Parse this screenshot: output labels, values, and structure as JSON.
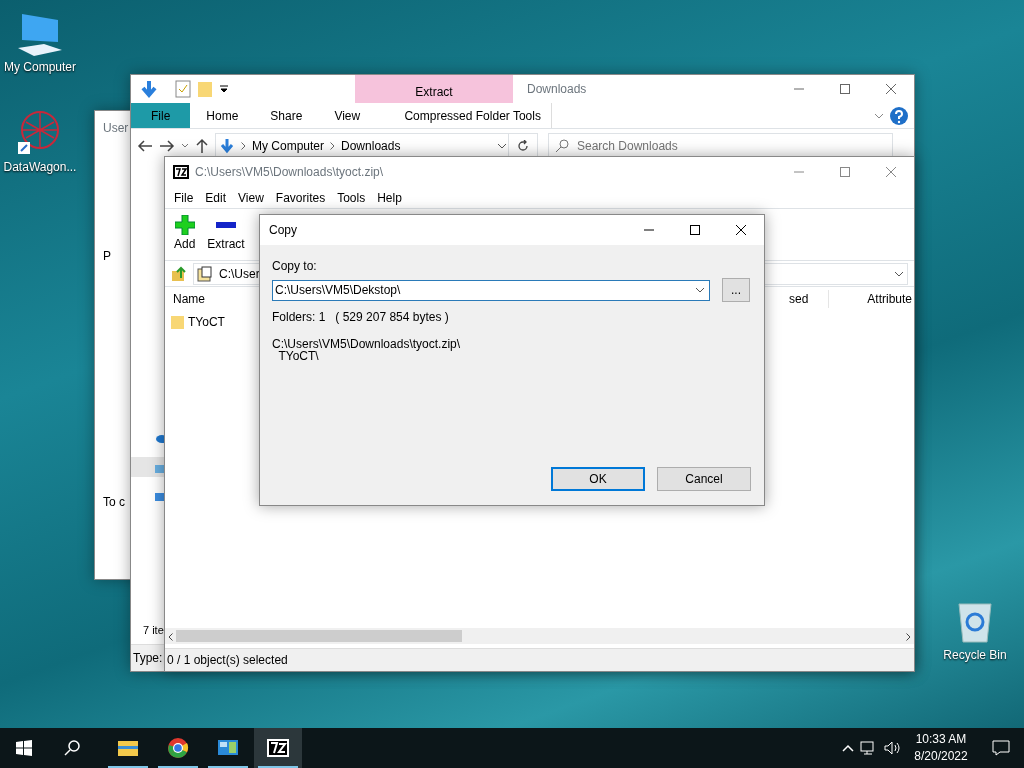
{
  "desktop_icons": [
    {
      "kind": "computer",
      "label": "My Computer"
    },
    {
      "kind": "app",
      "label": "DataWagon..."
    },
    {
      "kind": "bin",
      "label": "Recycle Bin"
    }
  ],
  "background_window": {
    "title": "User",
    "texts": [
      "P",
      "To c"
    ]
  },
  "explorer": {
    "title": "Downloads",
    "contextual_group": "Extract",
    "tabs": [
      {
        "label": "File",
        "selected": true
      },
      {
        "label": "Home",
        "selected": false
      },
      {
        "label": "Share",
        "selected": false
      },
      {
        "label": "View",
        "selected": false
      },
      {
        "label": "Compressed Folder Tools",
        "selected": false
      }
    ],
    "breadcrumb": [
      "My Computer",
      "Downloads"
    ],
    "search": {
      "placeholder": "Search Downloads"
    },
    "item_count": "7 ite",
    "type_label": "Type: "
  },
  "archive_window": {
    "title": "C:\\Users\\VM5\\Downloads\\tyoct.zip\\",
    "menu": [
      "File",
      "Edit",
      "View",
      "Favorites",
      "Tools",
      "Help"
    ],
    "toolbar": [
      {
        "kind": "add",
        "label": "Add"
      },
      {
        "kind": "extract",
        "label": "Extract"
      }
    ],
    "address": "C:\\User",
    "columns": [
      "Name",
      "sed",
      "Attribute"
    ],
    "rows": [
      {
        "name": "TYoCT"
      }
    ],
    "status": "0 / 1 object(s) selected"
  },
  "copy_dialog": {
    "title": "Copy",
    "label": "Copy to:",
    "value": "C:\\Users\\VM5\\Dekstop\\",
    "browse": "...",
    "info": "Folders: 1   ( 529 207 854 bytes )",
    "source": [
      "C:\\Users\\VM5\\Downloads\\tyoct.zip\\",
      "  TYoCT\\"
    ],
    "buttons": [
      {
        "label": "OK",
        "default": true
      },
      {
        "label": "Cancel",
        "default": false
      }
    ]
  },
  "taskbar": {
    "apps": [
      {
        "kind": "folder",
        "running": true,
        "active": false
      },
      {
        "kind": "browser",
        "running": true,
        "active": false
      },
      {
        "kind": "panel",
        "running": true,
        "active": false
      },
      {
        "kind": "archiver",
        "running": true,
        "active": true
      }
    ],
    "time": "10:33 AM",
    "date": "8/20/2022"
  }
}
